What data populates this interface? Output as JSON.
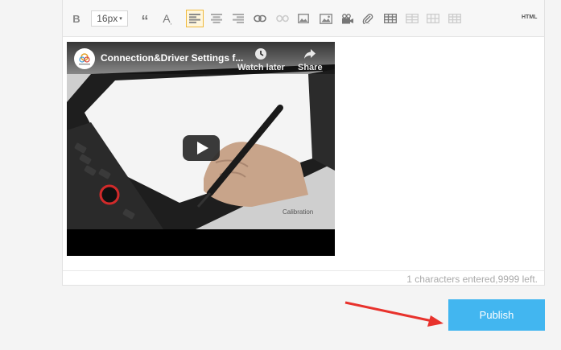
{
  "toolbar": {
    "bold_label": "B",
    "font_size": "16px",
    "font_size_caret": "▾",
    "quote_glyph": "“",
    "font_color_glyph": "A",
    "html_label": "HTML"
  },
  "video": {
    "title": "Connection&Driver Settings f...",
    "watch_later": "Watch later",
    "share": "Share",
    "caption": "Calibration",
    "play_icon": "play-icon"
  },
  "editor": {
    "char_count": "1 characters entered,9999 left."
  },
  "actions": {
    "publish_label": "Publish"
  },
  "colors": {
    "accent": "#42b6f0",
    "annotation_arrow": "#e8322c",
    "active_tool_border": "#f0b93b"
  }
}
